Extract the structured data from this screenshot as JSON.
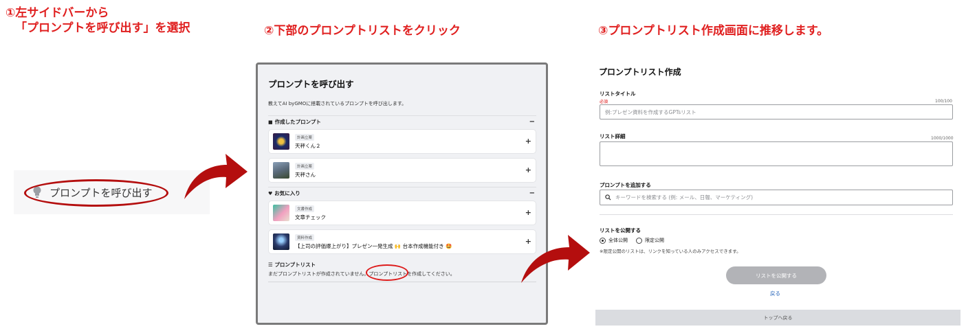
{
  "colors": {
    "accent_red": "#e02020",
    "arrow_red": "#b40e0e",
    "link_blue": "#2563b8"
  },
  "steps": {
    "step1": {
      "line1": "①左サイドバーから",
      "line2": "「プロンプトを呼び出す」を選択"
    },
    "step2": "②下部のプロンプトリストをクリック",
    "step3": "③プロンプトリスト作成画面に推移します。"
  },
  "sidebar": {
    "item_label": "プロンプトを呼び出す",
    "item_icon": "lightbulb-icon"
  },
  "panel2": {
    "title": "プロンプトを呼び出す",
    "description": "教えてAI byGMOに搭載されているプロンプトを呼び出します。",
    "created_section": {
      "icon": "folder-icon",
      "label": "作成したプロンプト",
      "collapse": "−"
    },
    "favorites_section": {
      "icon": "heart-icon",
      "label": "お気に入り",
      "collapse": "−"
    },
    "created_items": [
      {
        "badge": "計画立案",
        "name": "天秤くん２",
        "plus": "+"
      },
      {
        "badge": "計画立案",
        "name": "天秤さん",
        "plus": "+"
      }
    ],
    "favorite_items": [
      {
        "badge": "文書作成",
        "name": "文章チェック",
        "plus": "+"
      },
      {
        "badge": "資料作成",
        "name": "【上司の評価爆上がり】プレゼン一発生成 🙌 台本作成機能付き 🤩",
        "plus": "+"
      }
    ],
    "list_section": {
      "icon": "list-icon",
      "label": "プロンプトリスト"
    },
    "empty_text_before": "まだプロンプトリストが作成されていません。",
    "empty_link": "プロンプトリスト",
    "empty_text_after": "を作成してください。"
  },
  "form": {
    "title": "プロンプトリスト作成",
    "list_title_label": "リストタイトル",
    "required": "必須",
    "title_counter": "100/100",
    "title_placeholder": "例:プレゼン資料を作成するGPTsリスト",
    "detail_label": "リスト詳細",
    "detail_counter": "1000/1000",
    "add_prompt_label": "プロンプトを追加する",
    "search_placeholder": "キーワードを検索する (例: メール、日報、マーケティング)",
    "publish_label": "リストを公開する",
    "option_all": "全体公開",
    "option_limited": "限定公開",
    "selected_option": "全体公開",
    "note": "※限定公開のリストは、リンクを知っている人のみアクセスできます。",
    "publish_button": "リストを公開する",
    "back_link": "戻る",
    "top_link": "トップへ戻る"
  }
}
